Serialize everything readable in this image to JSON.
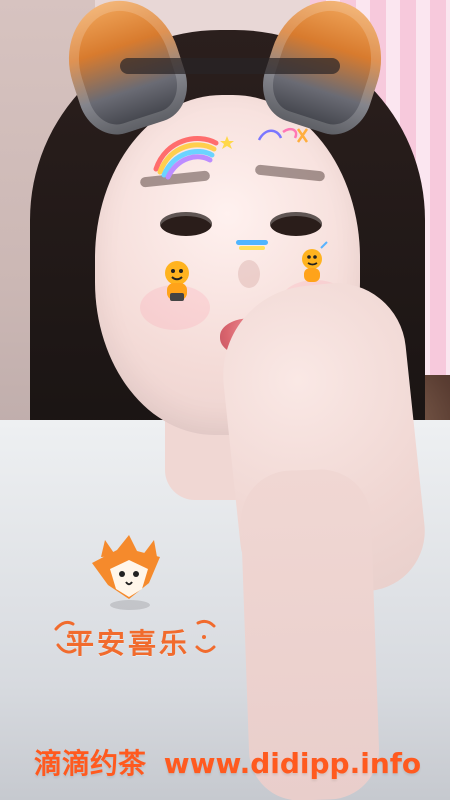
{
  "image": {
    "overlay": {
      "sticker_text": "平安喜乐",
      "watermark": {
        "brand": "滴滴约茶",
        "site": "www.didipp.info"
      }
    },
    "colors": {
      "watermark_orange": "#ff5a1f",
      "sticker_orange": "#f16b2d",
      "wallpaper_pink": "#f7c9dc",
      "hair_dark": "#1b1514"
    },
    "icons": [
      "fox-ears-icon",
      "rainbow-sticker-icon",
      "cartoon-mascot-icon",
      "fox-character-icon"
    ]
  }
}
